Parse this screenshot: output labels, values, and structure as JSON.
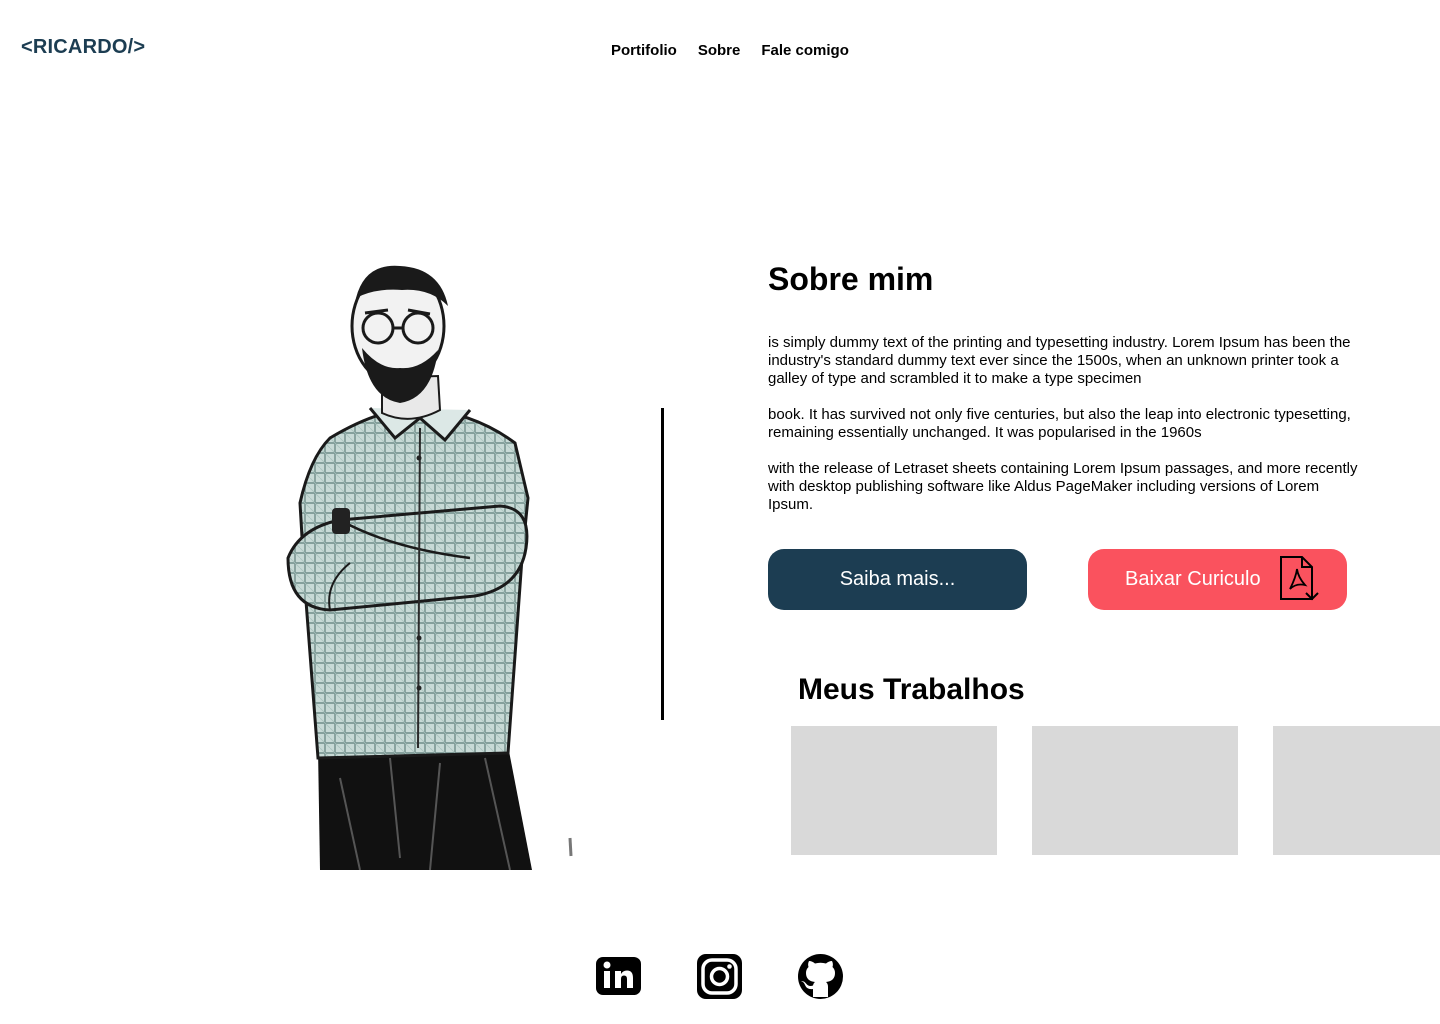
{
  "header": {
    "logo": "<RICARDO/>",
    "nav": [
      "Portifolio",
      "Sobre",
      "Fale comigo"
    ]
  },
  "about": {
    "title": "Sobre mim",
    "paragraphs": [
      " is simply dummy text of the printing and typesetting industry. Lorem Ipsum has been the industry's standard dummy text ever since the 1500s, when an unknown printer took a galley of type and scrambled it to make a type specimen",
      "book. It has survived not only five centuries, but also the leap into electronic typesetting, remaining essentially unchanged. It was popularised in the 1960s",
      "with the release of Letraset sheets containing Lorem Ipsum passages, and more recently with desktop publishing software like Aldus PageMaker including versions of Lorem Ipsum."
    ],
    "more_button": "Saiba mais...",
    "cv_button": "Baixar Curiculo",
    "cv_icon": "pdf-download-icon"
  },
  "works": {
    "title": "Meus Trabalhos",
    "cards": 3
  },
  "social": [
    "linkedin-icon",
    "instagram-icon",
    "github-icon"
  ],
  "colors": {
    "primary": "#1c3d52",
    "accent": "#fa525e",
    "placeholder": "#d9d9d9",
    "text": "#000000",
    "background": "#ffffff"
  }
}
